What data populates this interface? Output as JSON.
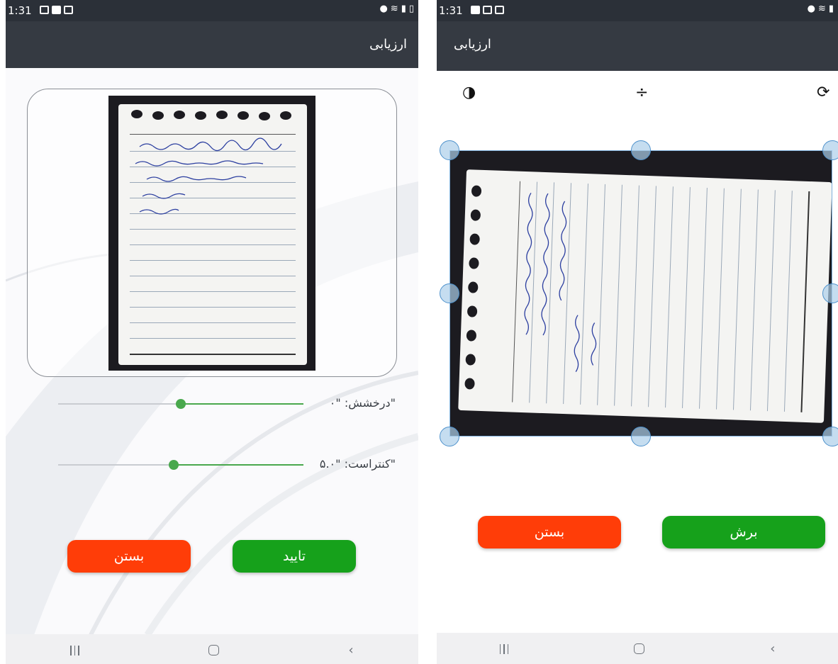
{
  "left_screen": {
    "status_time": "1:31",
    "app_title": "ارزیابی",
    "brightness": {
      "label": "\"درخشش: \"۰",
      "value": 0.5
    },
    "contrast": {
      "label": "\"کنتراست: \"۵.۰",
      "value": 0.47
    },
    "close_label": "بستن",
    "confirm_label": "تایید"
  },
  "right_screen": {
    "status_time": "1:31",
    "app_title": "ارزیابی",
    "toolbar_icons": [
      "contrast-icon",
      "compress-icon",
      "rotate-icon"
    ],
    "close_label": "بستن",
    "crop_label": "برش"
  },
  "colors": {
    "header": "#353a42",
    "status_bar": "#2b3038",
    "green": "#16a11b",
    "red": "#ff3d08",
    "slider": "#49a84d",
    "crop_handle": "#4f92cc"
  }
}
